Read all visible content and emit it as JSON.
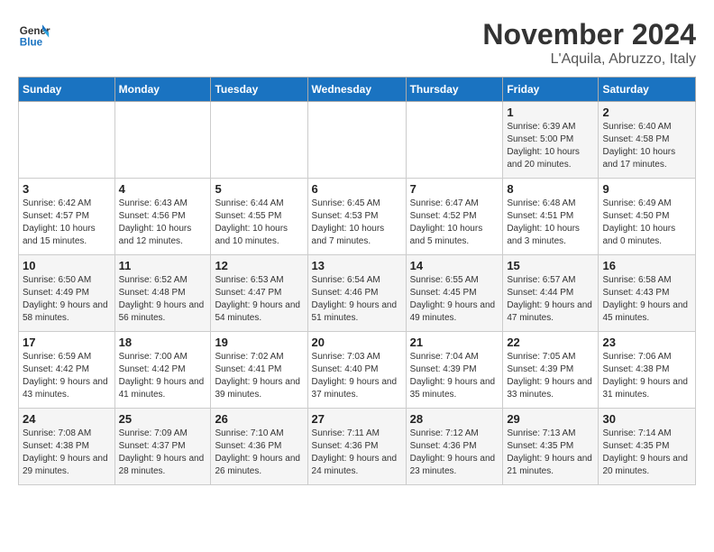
{
  "logo": {
    "line1": "General",
    "line2": "Blue"
  },
  "title": "November 2024",
  "subtitle": "L'Aquila, Abruzzo, Italy",
  "weekdays": [
    "Sunday",
    "Monday",
    "Tuesday",
    "Wednesday",
    "Thursday",
    "Friday",
    "Saturday"
  ],
  "weeks": [
    [
      {
        "day": "",
        "info": ""
      },
      {
        "day": "",
        "info": ""
      },
      {
        "day": "",
        "info": ""
      },
      {
        "day": "",
        "info": ""
      },
      {
        "day": "",
        "info": ""
      },
      {
        "day": "1",
        "info": "Sunrise: 6:39 AM\nSunset: 5:00 PM\nDaylight: 10 hours and 20 minutes."
      },
      {
        "day": "2",
        "info": "Sunrise: 6:40 AM\nSunset: 4:58 PM\nDaylight: 10 hours and 17 minutes."
      }
    ],
    [
      {
        "day": "3",
        "info": "Sunrise: 6:42 AM\nSunset: 4:57 PM\nDaylight: 10 hours and 15 minutes."
      },
      {
        "day": "4",
        "info": "Sunrise: 6:43 AM\nSunset: 4:56 PM\nDaylight: 10 hours and 12 minutes."
      },
      {
        "day": "5",
        "info": "Sunrise: 6:44 AM\nSunset: 4:55 PM\nDaylight: 10 hours and 10 minutes."
      },
      {
        "day": "6",
        "info": "Sunrise: 6:45 AM\nSunset: 4:53 PM\nDaylight: 10 hours and 7 minutes."
      },
      {
        "day": "7",
        "info": "Sunrise: 6:47 AM\nSunset: 4:52 PM\nDaylight: 10 hours and 5 minutes."
      },
      {
        "day": "8",
        "info": "Sunrise: 6:48 AM\nSunset: 4:51 PM\nDaylight: 10 hours and 3 minutes."
      },
      {
        "day": "9",
        "info": "Sunrise: 6:49 AM\nSunset: 4:50 PM\nDaylight: 10 hours and 0 minutes."
      }
    ],
    [
      {
        "day": "10",
        "info": "Sunrise: 6:50 AM\nSunset: 4:49 PM\nDaylight: 9 hours and 58 minutes."
      },
      {
        "day": "11",
        "info": "Sunrise: 6:52 AM\nSunset: 4:48 PM\nDaylight: 9 hours and 56 minutes."
      },
      {
        "day": "12",
        "info": "Sunrise: 6:53 AM\nSunset: 4:47 PM\nDaylight: 9 hours and 54 minutes."
      },
      {
        "day": "13",
        "info": "Sunrise: 6:54 AM\nSunset: 4:46 PM\nDaylight: 9 hours and 51 minutes."
      },
      {
        "day": "14",
        "info": "Sunrise: 6:55 AM\nSunset: 4:45 PM\nDaylight: 9 hours and 49 minutes."
      },
      {
        "day": "15",
        "info": "Sunrise: 6:57 AM\nSunset: 4:44 PM\nDaylight: 9 hours and 47 minutes."
      },
      {
        "day": "16",
        "info": "Sunrise: 6:58 AM\nSunset: 4:43 PM\nDaylight: 9 hours and 45 minutes."
      }
    ],
    [
      {
        "day": "17",
        "info": "Sunrise: 6:59 AM\nSunset: 4:42 PM\nDaylight: 9 hours and 43 minutes."
      },
      {
        "day": "18",
        "info": "Sunrise: 7:00 AM\nSunset: 4:42 PM\nDaylight: 9 hours and 41 minutes."
      },
      {
        "day": "19",
        "info": "Sunrise: 7:02 AM\nSunset: 4:41 PM\nDaylight: 9 hours and 39 minutes."
      },
      {
        "day": "20",
        "info": "Sunrise: 7:03 AM\nSunset: 4:40 PM\nDaylight: 9 hours and 37 minutes."
      },
      {
        "day": "21",
        "info": "Sunrise: 7:04 AM\nSunset: 4:39 PM\nDaylight: 9 hours and 35 minutes."
      },
      {
        "day": "22",
        "info": "Sunrise: 7:05 AM\nSunset: 4:39 PM\nDaylight: 9 hours and 33 minutes."
      },
      {
        "day": "23",
        "info": "Sunrise: 7:06 AM\nSunset: 4:38 PM\nDaylight: 9 hours and 31 minutes."
      }
    ],
    [
      {
        "day": "24",
        "info": "Sunrise: 7:08 AM\nSunset: 4:38 PM\nDaylight: 9 hours and 29 minutes."
      },
      {
        "day": "25",
        "info": "Sunrise: 7:09 AM\nSunset: 4:37 PM\nDaylight: 9 hours and 28 minutes."
      },
      {
        "day": "26",
        "info": "Sunrise: 7:10 AM\nSunset: 4:36 PM\nDaylight: 9 hours and 26 minutes."
      },
      {
        "day": "27",
        "info": "Sunrise: 7:11 AM\nSunset: 4:36 PM\nDaylight: 9 hours and 24 minutes."
      },
      {
        "day": "28",
        "info": "Sunrise: 7:12 AM\nSunset: 4:36 PM\nDaylight: 9 hours and 23 minutes."
      },
      {
        "day": "29",
        "info": "Sunrise: 7:13 AM\nSunset: 4:35 PM\nDaylight: 9 hours and 21 minutes."
      },
      {
        "day": "30",
        "info": "Sunrise: 7:14 AM\nSunset: 4:35 PM\nDaylight: 9 hours and 20 minutes."
      }
    ]
  ]
}
